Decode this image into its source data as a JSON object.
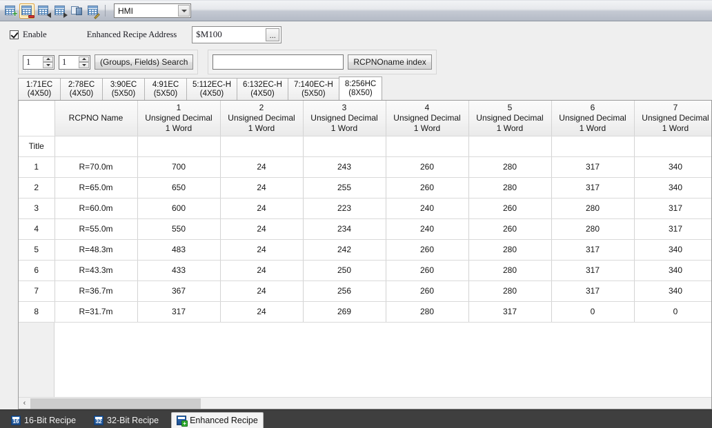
{
  "toolbar": {
    "buttons": [
      {
        "name": "add-recipe-icon",
        "title": "Add"
      },
      {
        "name": "delete-recipe-icon",
        "title": "Delete"
      },
      {
        "name": "import-recipe-icon",
        "title": "Import"
      },
      {
        "name": "export-recipe-icon",
        "title": "Export"
      },
      {
        "name": "copy-recipe-icon",
        "title": "Copy"
      },
      {
        "name": "edit-recipe-icon",
        "title": "Edit"
      }
    ],
    "device_combo": {
      "value": "HMI",
      "icon": "chevron-down-icon"
    }
  },
  "enable_row": {
    "checkbox_label": "Enable",
    "checked": true,
    "address_label": "Enhanced Recipe Address",
    "address_value": "$M100",
    "browse_button_label": "..."
  },
  "search_row": {
    "group_spinner_value": "1",
    "field_spinner_value": "1",
    "search_button_label": "(Groups, Fields) Search",
    "name_input_value": "",
    "name_input_placeholder": "",
    "index_button_label": "RCPNOname index"
  },
  "recipe_tabs": [
    {
      "line1": "1:71EC",
      "line2": "(4X50)",
      "selected": false
    },
    {
      "line1": "2:78EC",
      "line2": "(4X50)",
      "selected": false
    },
    {
      "line1": "3:90EC",
      "line2": "(5X50)",
      "selected": false
    },
    {
      "line1": "4:91EC",
      "line2": "(5X50)",
      "selected": false
    },
    {
      "line1": "5:112EC-H",
      "line2": "(4X50)",
      "selected": false
    },
    {
      "line1": "6:132EC-H",
      "line2": "(4X50)",
      "selected": false
    },
    {
      "line1": "7:140EC-H",
      "line2": "(5X50)",
      "selected": false
    },
    {
      "line1": "8:256HC",
      "line2": "(8X50)",
      "selected": true
    }
  ],
  "table": {
    "corner_label": "",
    "name_column_header": "RCPNO Name",
    "title_row_label": "Title",
    "title_row_name": "",
    "columns": [
      {
        "number": "1",
        "type": "Unsigned Decimal",
        "width": "1 Word"
      },
      {
        "number": "2",
        "type": "Unsigned Decimal",
        "width": "1 Word"
      },
      {
        "number": "3",
        "type": "Unsigned Decimal",
        "width": "1 Word"
      },
      {
        "number": "4",
        "type": "Unsigned Decimal",
        "width": "1 Word"
      },
      {
        "number": "5",
        "type": "Unsigned Decimal",
        "width": "1 Word"
      },
      {
        "number": "6",
        "type": "Unsigned Decimal",
        "width": "1 Word"
      },
      {
        "number": "7",
        "type": "Unsigned Decimal",
        "width": "1 Word"
      }
    ],
    "title_row_values": [
      "",
      "",
      "",
      "",
      "",
      "",
      ""
    ],
    "rows": [
      {
        "index": "1",
        "name": "R=70.0m",
        "values": [
          "700",
          "24",
          "243",
          "260",
          "280",
          "317",
          "340"
        ]
      },
      {
        "index": "2",
        "name": "R=65.0m",
        "values": [
          "650",
          "24",
          "255",
          "260",
          "280",
          "317",
          "340"
        ]
      },
      {
        "index": "3",
        "name": "R=60.0m",
        "values": [
          "600",
          "24",
          "223",
          "240",
          "260",
          "280",
          "317"
        ]
      },
      {
        "index": "4",
        "name": "R=55.0m",
        "values": [
          "550",
          "24",
          "234",
          "240",
          "260",
          "280",
          "317"
        ]
      },
      {
        "index": "5",
        "name": "R=48.3m",
        "values": [
          "483",
          "24",
          "242",
          "260",
          "280",
          "317",
          "340"
        ]
      },
      {
        "index": "6",
        "name": "R=43.3m",
        "values": [
          "433",
          "24",
          "250",
          "260",
          "280",
          "317",
          "340"
        ]
      },
      {
        "index": "7",
        "name": "R=36.7m",
        "values": [
          "367",
          "24",
          "256",
          "260",
          "280",
          "317",
          "340"
        ]
      },
      {
        "index": "8",
        "name": "R=31.7m",
        "values": [
          "317",
          "24",
          "269",
          "280",
          "317",
          "0",
          "0"
        ]
      }
    ]
  },
  "hscrollbar": {
    "left_arrow_glyph": "‹",
    "thumb_percent": 25
  },
  "bottom_tabs": [
    {
      "label": "16-Bit Recipe",
      "icon_text": "16",
      "selected": false,
      "has_plus": false
    },
    {
      "label": "32-Bit Recipe",
      "icon_text": "32",
      "selected": false,
      "has_plus": false
    },
    {
      "label": "Enhanced Recipe",
      "icon_text": "",
      "selected": true,
      "has_plus": true
    }
  ],
  "colors": {
    "toolbar_top": "#f2f3f5",
    "toolbar_bottom": "#b4bac6",
    "accent_selected_tab": "#ffffff",
    "bottom_bar": "#3f3f3f",
    "grid_border": "#d3d3d3",
    "add_badge_green": "#2e9b2e",
    "delete_badge_red": "#d03232"
  }
}
